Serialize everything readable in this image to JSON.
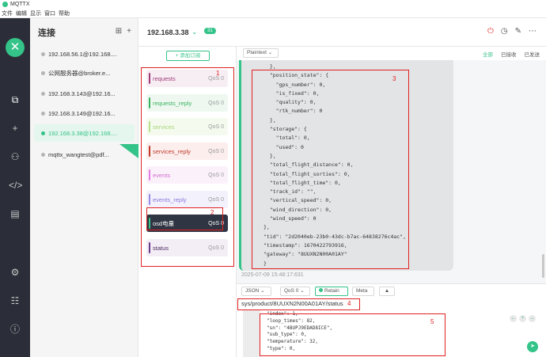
{
  "window": {
    "title": "MQTTX"
  },
  "menu": [
    "文件",
    "编辑",
    "显示",
    "窗口",
    "帮助"
  ],
  "sidebar": {
    "title": "连接",
    "connections": [
      {
        "label": "192.168.56.1@192.168....",
        "active": false
      },
      {
        "label": "公网服务器@broker.e...",
        "active": false
      },
      {
        "label": "192.168.3.143@192.16...",
        "active": false
      },
      {
        "label": "192.168.3.149@192.16...",
        "active": false
      },
      {
        "label": "192.168.3.38@192.168....",
        "active": true
      },
      {
        "label": "mqttx_wangtest@pdf...",
        "active": false
      }
    ]
  },
  "header": {
    "host": "192.168.3.38",
    "count": "31"
  },
  "subscriptions": {
    "add_label": "+ 添加订阅",
    "items": [
      {
        "topic": "requests",
        "qos": "QoS 0",
        "color": "#a13a7a"
      },
      {
        "topic": "requests_reply",
        "qos": "QoS 0",
        "color": "#3bb35e"
      },
      {
        "topic": "services",
        "qos": "QoS 0",
        "color": "#b8e08e"
      },
      {
        "topic": "services_reply",
        "qos": "QoS 0",
        "color": "#c0392b"
      },
      {
        "topic": "events",
        "qos": "QoS 0",
        "color": "#e27fe0"
      },
      {
        "topic": "events_reply",
        "qos": "QoS 0",
        "color": "#9b8be6"
      },
      {
        "topic": "osd电量",
        "qos": "QoS 0",
        "color": "#34c388"
      },
      {
        "topic": "status",
        "qos": "QoS 0",
        "color": "#6a3a8a"
      }
    ]
  },
  "messages": {
    "format": "Plaintext",
    "filters": [
      "全部",
      "已接收",
      "已发送"
    ],
    "code": "  },\n  \"position_state\": {\n    \"gps_number\": 0,\n    \"is_fixed\": 0,\n    \"quality\": 0,\n    \"rtk_number\": 0\n  },\n  \"storage\": {\n    \"total\": 0,\n    \"used\": 0\n  },\n  \"total_flight_distance\": 0,\n  \"total_flight_sorties\": 0,\n  \"total_flight_time\": 0,\n  \"track_id\": \"\",\n  \"vertical_speed\": 0,\n  \"wind_direction\": 0,\n  \"wind_speed\": 0\n},\n\"tid\": \"2d2040eb-23b0-43dc-b7ac-64838276c4ac\",\n\"timestamp\": 1670422793916,\n\"gateway\": \"8UUXN2N00A01AY\"\n}",
    "timestamp": "2025-07-09 15:48:17:631"
  },
  "publish": {
    "format": "JSON",
    "qos": "QoS 0",
    "retain": "Retain",
    "meta": "Meta",
    "topic": "sys/product/8UUXN2N00A01AY/status",
    "payload": "\"index\": 1,\n\"loop_times\": 82,\n\"sn\": \"4BUPJ9EDAD8ICE\",\n\"sub_type\": 0,\n\"temperature\": 32,\n\"type\": 0,"
  },
  "annotations": [
    "1",
    "2",
    "3",
    "4",
    "5"
  ]
}
